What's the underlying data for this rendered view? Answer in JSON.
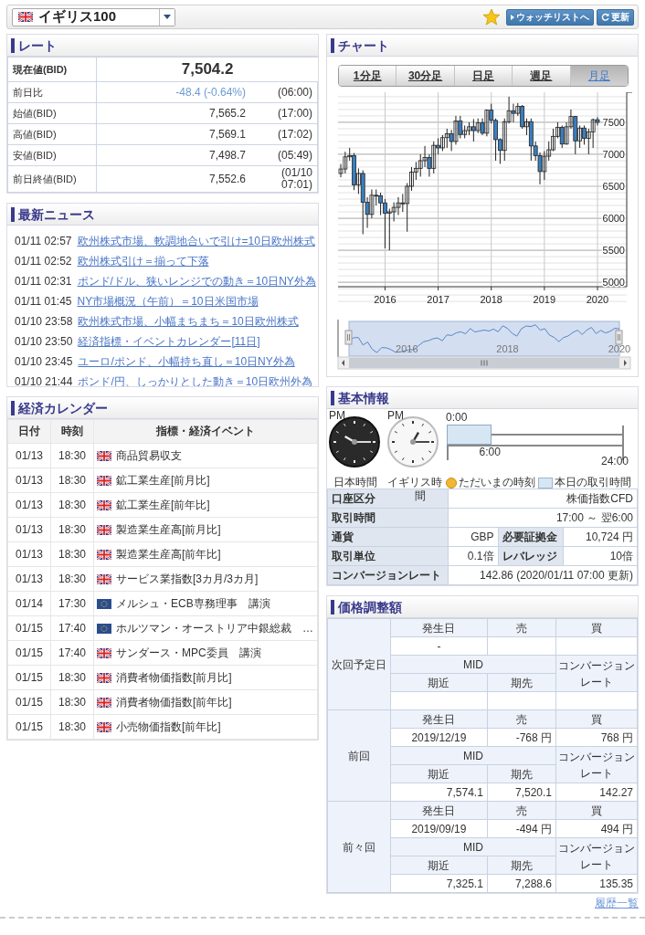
{
  "header": {
    "instrument": "イギリス100",
    "watchlist_button": "ウォッチリストへ",
    "refresh_button": "更新"
  },
  "rate": {
    "title": "レート",
    "rows": [
      {
        "kind": "main",
        "label": "現在値(BID)",
        "value": "7,504.2"
      },
      {
        "kind": "down",
        "label": "前日比",
        "value": "-48.4 (-0.64%)",
        "time": "(06:00)"
      },
      {
        "kind": "plain",
        "label": "始値(BID)",
        "value": "7,565.2",
        "time": "(17:00)"
      },
      {
        "kind": "plain",
        "label": "高値(BID)",
        "value": "7,569.1",
        "time": "(17:02)"
      },
      {
        "kind": "plain",
        "label": "安値(BID)",
        "value": "7,498.7",
        "time": "(05:49)"
      },
      {
        "kind": "plain",
        "label": "前日終値(BID)",
        "value": "7,552.6",
        "time": "(01/10 07:01)"
      }
    ]
  },
  "news": {
    "title": "最新ニュース",
    "items": [
      {
        "time": "01/11 02:57",
        "headline": "欧州株式市場、軟調地合いで引け=10日欧州株式"
      },
      {
        "time": "01/11 02:52",
        "headline": "欧州株式引け＝揃って下落"
      },
      {
        "time": "01/11 02:31",
        "headline": "ポンド/ドル、狭いレンジでの動き＝10日NY外為"
      },
      {
        "time": "01/11 01:45",
        "headline": "NY市場概況（午前）＝10日米国市場"
      },
      {
        "time": "01/10 23:58",
        "headline": "欧州株式市場、小幅まちまち＝10日欧州株式"
      },
      {
        "time": "01/10 23:50",
        "headline": "経済指標・イベントカレンダー[11日]"
      },
      {
        "time": "01/10 23:45",
        "headline": "ユーロ/ポンド、小幅持ち直し＝10日NY外為"
      },
      {
        "time": "01/10 21:44",
        "headline": "ポンド/円、しっかりとした動き＝10日欧州外為"
      }
    ]
  },
  "calendar": {
    "title": "経済カレンダー",
    "columns": [
      "日付",
      "時刻",
      "指標・経済イベント"
    ],
    "rows": [
      {
        "date": "01/13",
        "time": "18:30",
        "kind": "uk",
        "event": "商品貿易収支"
      },
      {
        "date": "01/13",
        "time": "18:30",
        "kind": "uk",
        "event": "鉱工業生産[前月比]"
      },
      {
        "date": "01/13",
        "time": "18:30",
        "kind": "uk",
        "event": "鉱工業生産[前年比]"
      },
      {
        "date": "01/13",
        "time": "18:30",
        "kind": "uk",
        "event": "製造業生産高[前月比]"
      },
      {
        "date": "01/13",
        "time": "18:30",
        "kind": "uk",
        "event": "製造業生産高[前年比]"
      },
      {
        "date": "01/13",
        "time": "18:30",
        "kind": "uk",
        "event": "サービス業指数[3カ月/3カ月]"
      },
      {
        "date": "01/14",
        "time": "17:30",
        "kind": "eu",
        "event": "メルシュ・ECB専務理事　講演"
      },
      {
        "date": "01/15",
        "time": "17:40",
        "kind": "eu",
        "event": "ホルツマン・オーストリア中銀総裁　…"
      },
      {
        "date": "01/15",
        "time": "17:40",
        "kind": "uk",
        "event": "サンダース・MPC委員　講演"
      },
      {
        "date": "01/15",
        "time": "18:30",
        "kind": "uk",
        "event": "消費者物価指数[前月比]"
      },
      {
        "date": "01/15",
        "time": "18:30",
        "kind": "uk",
        "event": "消費者物価指数[前年比]"
      },
      {
        "date": "01/15",
        "time": "18:30",
        "kind": "uk",
        "event": "小売物価指数[前年比]"
      }
    ]
  },
  "chart": {
    "title": "チャート",
    "tabs": [
      {
        "label": "1分足",
        "selected": false
      },
      {
        "label": "30分足",
        "selected": false
      },
      {
        "label": "日足",
        "selected": false
      },
      {
        "label": "週足",
        "selected": false
      },
      {
        "label": "月足",
        "selected": true
      }
    ],
    "chart_data": {
      "type": "candlestick",
      "grid": true,
      "xlim": [
        "2015-03",
        "2020-01"
      ],
      "ylim": [
        4930,
        7970
      ],
      "yticks": [
        7500,
        7000,
        6500,
        6000,
        5500,
        5000
      ],
      "xticks": [
        {
          "value": "2016-01",
          "label": "2016"
        },
        {
          "value": "2017-01",
          "label": "2017"
        },
        {
          "value": "2018-01",
          "label": "2018"
        },
        {
          "value": "2019-01",
          "label": "2019"
        },
        {
          "value": "2020-01",
          "label": "2020"
        }
      ],
      "x": [
        "2015-03",
        "2015-04",
        "2015-05",
        "2015-06",
        "2015-07",
        "2015-08",
        "2015-09",
        "2015-10",
        "2015-11",
        "2015-12",
        "2016-01",
        "2016-02",
        "2016-03",
        "2016-04",
        "2016-05",
        "2016-06",
        "2016-07",
        "2016-08",
        "2016-09",
        "2016-10",
        "2016-11",
        "2016-12",
        "2017-01",
        "2017-02",
        "2017-03",
        "2017-04",
        "2017-05",
        "2017-06",
        "2017-07",
        "2017-08",
        "2017-09",
        "2017-10",
        "2017-11",
        "2017-12",
        "2018-01",
        "2018-02",
        "2018-03",
        "2018-04",
        "2018-05",
        "2018-06",
        "2018-07",
        "2018-08",
        "2018-09",
        "2018-10",
        "2018-11",
        "2018-12",
        "2019-01",
        "2019-02",
        "2019-03",
        "2019-04",
        "2019-05",
        "2019-06",
        "2019-07",
        "2019-08",
        "2019-09",
        "2019-10",
        "2019-11",
        "2019-12",
        "2020-01"
      ],
      "ohlc": [
        [
          6700,
          6850,
          6640,
          6770
        ],
        [
          6770,
          7040,
          6700,
          6960
        ],
        [
          6960,
          7100,
          6900,
          6980
        ],
        [
          6980,
          7020,
          6440,
          6520
        ],
        [
          6520,
          6780,
          6380,
          6700
        ],
        [
          6700,
          6750,
          5750,
          6250
        ],
        [
          6250,
          6330,
          5850,
          6060
        ],
        [
          6060,
          6450,
          6000,
          6360
        ],
        [
          6360,
          6450,
          6200,
          6350
        ],
        [
          6350,
          6400,
          6050,
          6240
        ],
        [
          6240,
          6300,
          5530,
          6080
        ],
        [
          6080,
          6150,
          5500,
          6100
        ],
        [
          6100,
          6250,
          5950,
          6170
        ],
        [
          6170,
          6330,
          6050,
          6240
        ],
        [
          6240,
          6380,
          6100,
          6230
        ],
        [
          6230,
          6550,
          5790,
          6500
        ],
        [
          6500,
          6800,
          6430,
          6720
        ],
        [
          6720,
          6880,
          6600,
          6780
        ],
        [
          6780,
          7000,
          6650,
          6900
        ],
        [
          6900,
          7130,
          6800,
          6950
        ],
        [
          6950,
          7000,
          6650,
          6780
        ],
        [
          6780,
          7200,
          6700,
          7140
        ],
        [
          7140,
          7250,
          7000,
          7100
        ],
        [
          7100,
          7300,
          7050,
          7260
        ],
        [
          7260,
          7400,
          7100,
          7320
        ],
        [
          7320,
          7380,
          7050,
          7200
        ],
        [
          7200,
          7600,
          7150,
          7520
        ],
        [
          7520,
          7600,
          7250,
          7310
        ],
        [
          7310,
          7450,
          7250,
          7370
        ],
        [
          7370,
          7500,
          7300,
          7430
        ],
        [
          7430,
          7550,
          7200,
          7370
        ],
        [
          7370,
          7560,
          7330,
          7490
        ],
        [
          7490,
          7560,
          7300,
          7330
        ],
        [
          7330,
          7700,
          7280,
          7690
        ],
        [
          7690,
          7790,
          7480,
          7530
        ],
        [
          7530,
          7560,
          6900,
          7230
        ],
        [
          7230,
          7250,
          6850,
          7060
        ],
        [
          7060,
          7560,
          6900,
          7510
        ],
        [
          7510,
          7900,
          7480,
          7680
        ],
        [
          7680,
          7790,
          7500,
          7640
        ],
        [
          7640,
          7800,
          7600,
          7750
        ],
        [
          7750,
          7770,
          7400,
          7430
        ],
        [
          7430,
          7560,
          7300,
          7510
        ],
        [
          7510,
          7560,
          6900,
          7130
        ],
        [
          7130,
          7200,
          6900,
          6980
        ],
        [
          6980,
          7030,
          6530,
          6730
        ],
        [
          6730,
          7050,
          6600,
          6970
        ],
        [
          6970,
          7200,
          6900,
          7070
        ],
        [
          7070,
          7400,
          7050,
          7280
        ],
        [
          7280,
          7500,
          7250,
          7420
        ],
        [
          7420,
          7450,
          7100,
          7160
        ],
        [
          7160,
          7500,
          7150,
          7430
        ],
        [
          7430,
          7700,
          7400,
          7590
        ],
        [
          7590,
          7600,
          7000,
          7210
        ],
        [
          7210,
          7450,
          7100,
          7410
        ],
        [
          7410,
          7450,
          7150,
          7250
        ],
        [
          7250,
          7400,
          7000,
          7350
        ],
        [
          7350,
          7560,
          7100,
          7540
        ],
        [
          7540,
          7580,
          7450,
          7500
        ]
      ]
    },
    "navigator_labels": [
      "2016",
      "2018",
      "2020"
    ]
  },
  "info": {
    "title": "基本情報",
    "clocks": [
      {
        "meridiem": "PM",
        "label": "日本時間",
        "kind": "dark"
      },
      {
        "meridiem": "PM",
        "label": "イギリス時",
        "kind": "light",
        "label_overflow": "間"
      }
    ],
    "timeline": {
      "start": "0:00",
      "session_end": "6:00",
      "end": "24:00",
      "level": 0.25
    },
    "legend": [
      {
        "kind": "now",
        "label": "ただいまの時刻"
      },
      {
        "kind": "session",
        "label": "本日の取引時間"
      }
    ],
    "rows": [
      [
        {
          "label": "口座区分",
          "value": "株価指数CFD"
        }
      ],
      [
        {
          "label": "取引時間",
          "value": "17:00 ～ 翌6:00"
        }
      ],
      [
        {
          "label": "通貨",
          "value": "GBP"
        },
        {
          "label": "必要証拠金",
          "value": "10,724 円"
        }
      ],
      [
        {
          "label": "取引単位",
          "value": "0.1倍"
        },
        {
          "label": "レバレッジ",
          "value": "10倍"
        }
      ],
      [
        {
          "label": "コンバージョンレート",
          "value": "142.86  (2020/01/11 07:00 更新)"
        }
      ]
    ]
  },
  "price": {
    "title": "価格調整額",
    "groups": [
      {
        "label": "次回予定日",
        "date_header": "発生日",
        "sell_header": "売",
        "buy_header": "買",
        "date": "-",
        "mid_header": "MID",
        "rate_header": "コンバージョンレート",
        "near_header": "期近",
        "far_header": "期先"
      },
      {
        "label": "前回",
        "date_header": "発生日",
        "sell_header": "売",
        "buy_header": "買",
        "date": "2019/12/19",
        "sell": "-768 円",
        "buy": "768 円",
        "mid_header": "MID",
        "rate_header": "コンバージョンレート",
        "near_header": "期近",
        "far_header": "期先",
        "near": "7,574.1",
        "far": "7,520.1",
        "rate": "142.27"
      },
      {
        "label": "前々回",
        "date_header": "発生日",
        "sell_header": "売",
        "buy_header": "買",
        "date": "2019/09/19",
        "sell": "-494 円",
        "buy": "494 円",
        "mid_header": "MID",
        "rate_header": "コンバージョンレート",
        "near_header": "期近",
        "far_header": "期先",
        "near": "7,325.1",
        "far": "7,288.6",
        "rate": "135.35"
      }
    ],
    "history_link": "履歴一覧"
  }
}
